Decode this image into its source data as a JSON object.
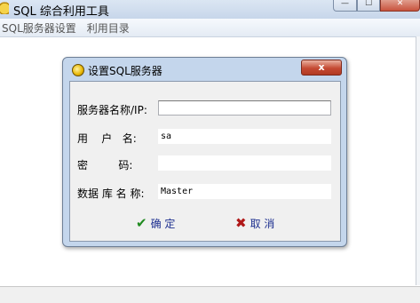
{
  "window": {
    "title": "SQL 综合利用工具",
    "controls": {
      "minimize": "—",
      "maximize": "☐",
      "close": "✕"
    }
  },
  "menu": {
    "items": [
      "SQL服务器设置",
      "利用目录"
    ]
  },
  "dialog": {
    "title": "设置SQL服务器",
    "close": "x",
    "fields": [
      {
        "label": "服务器名称/IP:",
        "value": ""
      },
      {
        "label": "用    户   名:",
        "value": "sa"
      },
      {
        "label": "密         码:",
        "value": ""
      },
      {
        "label": "数据 库 名 称:",
        "value": "Master"
      }
    ],
    "ok": {
      "icon": "✔",
      "label": "确 定"
    },
    "cancel": {
      "icon": "✖",
      "label": "取 消"
    }
  },
  "colors": {
    "accent": "#1d2f8f",
    "ok_icon": "#1f8a1f",
    "cancel_icon": "#b01818",
    "dialog_frame": "#c4d6ec"
  }
}
